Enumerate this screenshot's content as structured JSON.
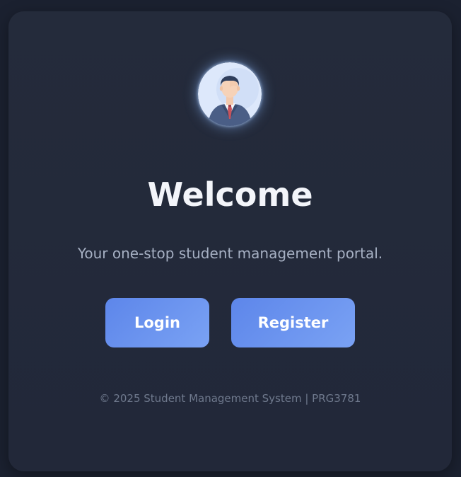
{
  "avatar": {
    "icon": "businessman-avatar-icon"
  },
  "hero": {
    "title": "Welcome",
    "subtitle": "Your one-stop student management portal."
  },
  "actions": {
    "login_label": "Login",
    "register_label": "Register"
  },
  "footer": {
    "text": "© 2025 Student Management System | PRG3781"
  },
  "colors": {
    "background": "#1b2130",
    "card": "#242b3b",
    "accent_start": "#5d86ea",
    "accent_end": "#7aa2f4"
  }
}
